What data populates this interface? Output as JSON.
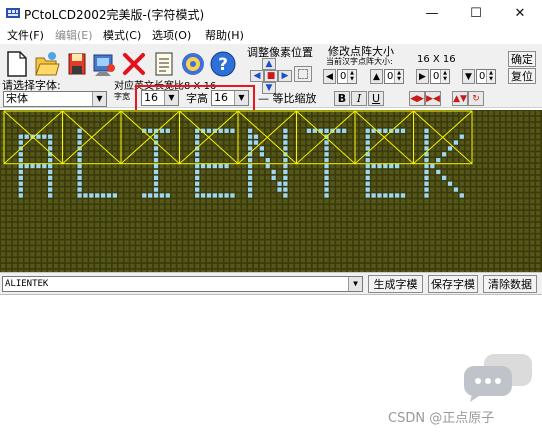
{
  "window": {
    "title": "PCtoLCD2002完美版-(字符模式)",
    "controls": {
      "minimize": "—",
      "maximize": "☐",
      "close": "✕"
    }
  },
  "menu": [
    {
      "label": "文件(F)",
      "enabled": true
    },
    {
      "label": "编辑(E)",
      "enabled": false
    },
    {
      "label": "模式(C)",
      "enabled": true
    },
    {
      "label": "选项(O)",
      "enabled": true
    },
    {
      "label": "帮助(H)",
      "enabled": true
    }
  ],
  "toolbar": {
    "icons": [
      "new-file-icon",
      "open-folder-icon",
      "save-disk-icon",
      "export-icon",
      "delete-x-icon",
      "notes-icon",
      "settings-gear-icon",
      "help-icon"
    ],
    "font_select_label": "请选择字体:",
    "font_value": "宋体",
    "pixel_adjust_label": "调整像素位置",
    "matrix_size_label": "修改点阵大小",
    "current_size_label": "当前汉字点阵大小:",
    "current_size_value": "16 X 16",
    "confirm_btn": "确定",
    "reset_btn": "复位",
    "charinfo_label": "对应英文长宽比8 X 16",
    "char_width_label": "字宽",
    "char_width_value": "16",
    "char_height_label": "字高",
    "char_height_value": "16",
    "scale_label": "等比缩放",
    "bold_btn": "B",
    "italic_btn": "I",
    "underline_btn": "U",
    "offset_values": [
      "0",
      "0",
      "0",
      "0"
    ]
  },
  "lcd": {
    "text": "ALIENTEK",
    "background_color": "#3a3a0a",
    "pixel_off_color": "#55561a",
    "pixel_on_color": "#9fd8f2",
    "grid_color": "#6c6d28",
    "cell_guide_color": "#f5f500"
  },
  "bottom": {
    "input_value": "ALIENTEK",
    "generate_btn": "生成字模",
    "save_btn": "保存字模",
    "clear_btn": "清除数据"
  },
  "watermark": "CSDN @正点原子"
}
